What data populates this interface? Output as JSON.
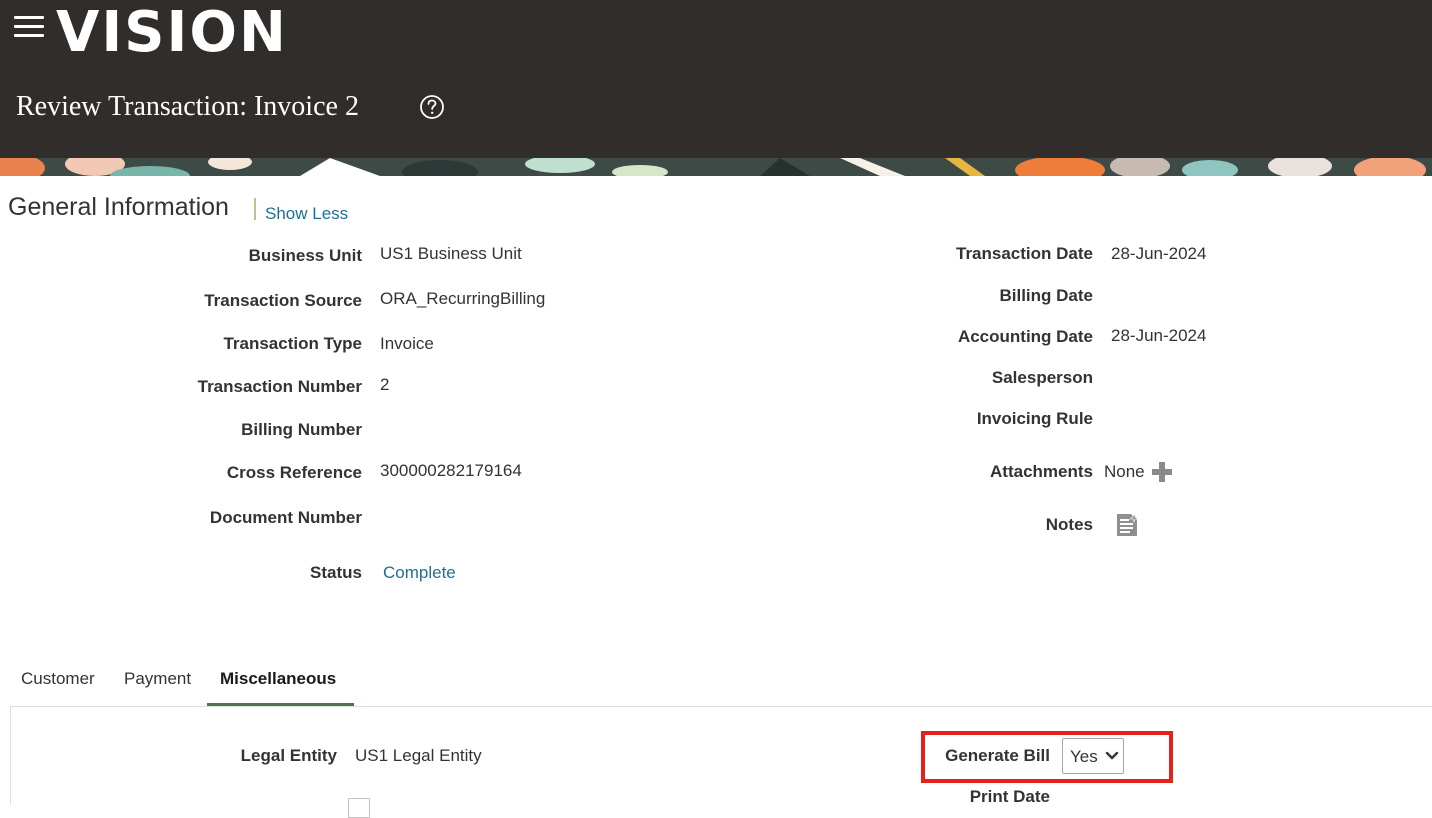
{
  "app": {
    "logo": "VISION",
    "page_title": "Review Transaction: Invoice 2"
  },
  "colors": {
    "header_bg": "#312d2a",
    "link": "#1f6f94",
    "tab_underline": "#55714b",
    "highlight": "#e8201d"
  },
  "icons": {
    "menu": "hamburger-menu-icon",
    "help": "help-circle-icon",
    "add": "plus-icon",
    "notes": "notes-icon",
    "dropdown": "chevron-down-icon"
  },
  "general_information": {
    "title": "General Information",
    "show_less": "Show Less",
    "left_fields": [
      {
        "label": "Business Unit",
        "value": "US1 Business Unit"
      },
      {
        "label": "Transaction Source",
        "value": "ORA_RecurringBilling"
      },
      {
        "label": "Transaction Type",
        "value": "Invoice"
      },
      {
        "label": "Transaction Number",
        "value": "2"
      },
      {
        "label": "Billing Number",
        "value": ""
      },
      {
        "label": "Cross Reference",
        "value": "300000282179164"
      },
      {
        "label": "Document Number",
        "value": ""
      },
      {
        "label": "Status",
        "value": "Complete"
      }
    ],
    "right_fields": [
      {
        "label": "Transaction Date",
        "value": "28-Jun-2024"
      },
      {
        "label": "Billing Date",
        "value": ""
      },
      {
        "label": "Accounting Date",
        "value": "28-Jun-2024"
      },
      {
        "label": "Salesperson",
        "value": ""
      },
      {
        "label": "Invoicing Rule",
        "value": ""
      },
      {
        "label": "Attachments",
        "value": "None"
      },
      {
        "label": "Notes",
        "value": ""
      }
    ]
  },
  "tabs": [
    {
      "label": "Customer"
    },
    {
      "label": "Payment"
    },
    {
      "label": "Miscellaneous",
      "active": true
    }
  ],
  "miscellaneous": {
    "legal_entity_label": "Legal Entity",
    "legal_entity_value": "US1 Legal Entity",
    "generate_bill_label": "Generate Bill",
    "generate_bill_value": "Yes",
    "print_date_label": "Print Date"
  }
}
